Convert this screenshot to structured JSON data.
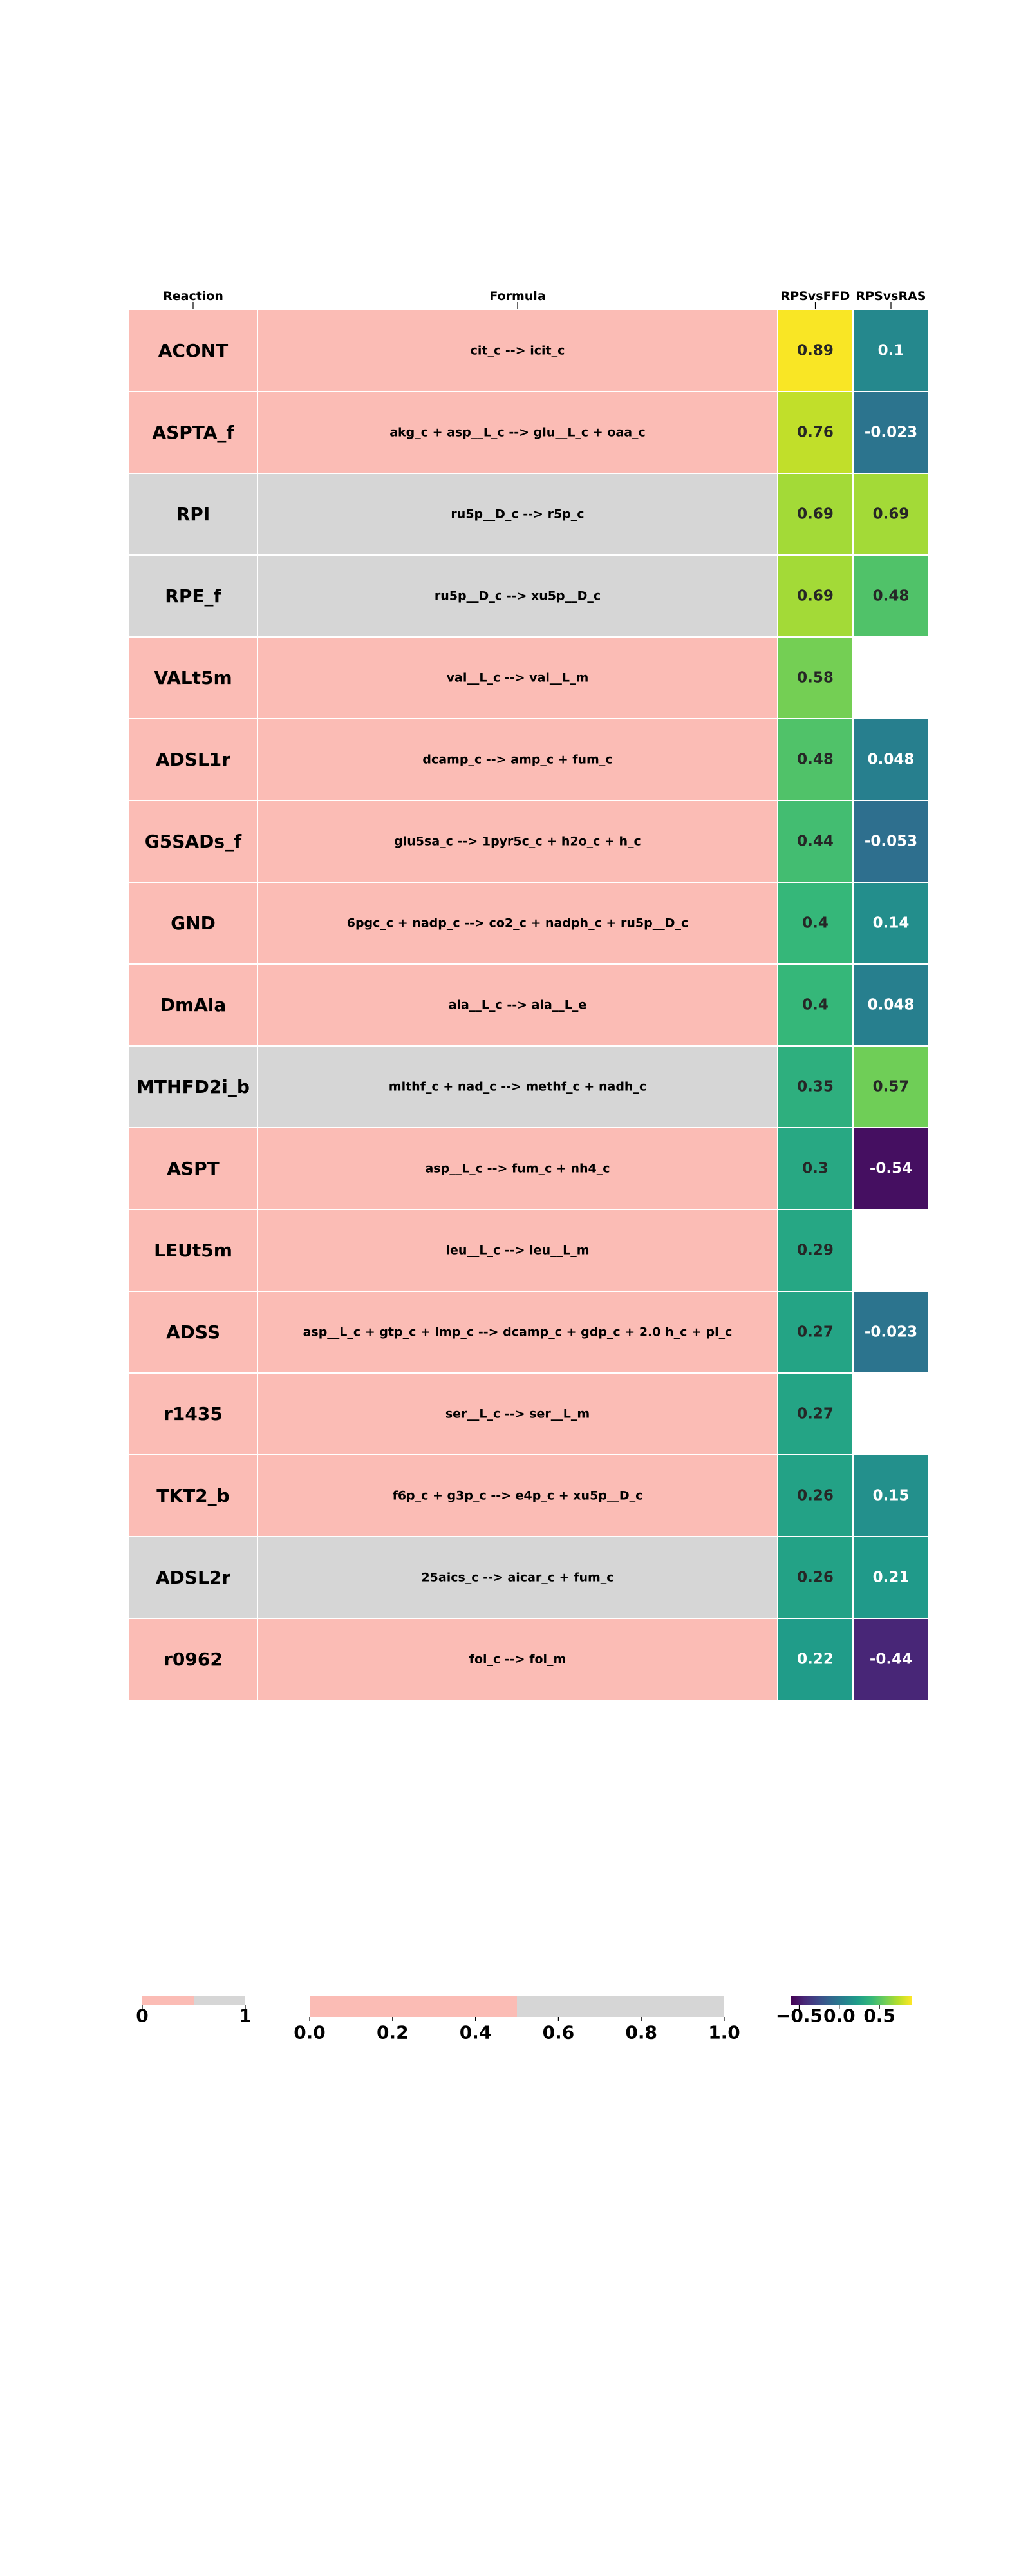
{
  "chart_data": {
    "type": "heatmap",
    "columns": [
      "Reaction",
      "Formula",
      "RPSvsFFD",
      "RPSvsRAS"
    ],
    "rows": [
      {
        "reaction": "ACONT",
        "formula": "cit_c --> icit_c",
        "category": 0,
        "RPSvsFFD": 0.89,
        "RPSvsRAS": 0.1,
        "labels": [
          "0.89",
          "0.1"
        ]
      },
      {
        "reaction": "ASPTA_f",
        "formula": "akg_c + asp__L_c --> glu__L_c + oaa_c",
        "category": 0,
        "RPSvsFFD": 0.76,
        "RPSvsRAS": -0.023,
        "labels": [
          "0.76",
          "-0.023"
        ]
      },
      {
        "reaction": "RPI",
        "formula": "ru5p__D_c --> r5p_c",
        "category": 1,
        "RPSvsFFD": 0.69,
        "RPSvsRAS": 0.69,
        "labels": [
          "0.69",
          "0.69"
        ]
      },
      {
        "reaction": "RPE_f",
        "formula": "ru5p__D_c --> xu5p__D_c",
        "category": 1,
        "RPSvsFFD": 0.69,
        "RPSvsRAS": 0.48,
        "labels": [
          "0.69",
          "0.48"
        ]
      },
      {
        "reaction": "VALt5m",
        "formula": "val__L_c --> val__L_m",
        "category": 0,
        "RPSvsFFD": 0.58,
        "RPSvsRAS": null,
        "labels": [
          "0.58",
          ""
        ]
      },
      {
        "reaction": "ADSL1r",
        "formula": "dcamp_c --> amp_c + fum_c",
        "category": 0,
        "RPSvsFFD": 0.48,
        "RPSvsRAS": 0.048,
        "labels": [
          "0.48",
          "0.048"
        ]
      },
      {
        "reaction": "G5SADs_f",
        "formula": "glu5sa_c --> 1pyr5c_c + h2o_c + h_c",
        "category": 0,
        "RPSvsFFD": 0.44,
        "RPSvsRAS": -0.053,
        "labels": [
          "0.44",
          "-0.053"
        ]
      },
      {
        "reaction": "GND",
        "formula": "6pgc_c + nadp_c --> co2_c + nadph_c + ru5p__D_c",
        "category": 0,
        "RPSvsFFD": 0.4,
        "RPSvsRAS": 0.14,
        "labels": [
          "0.4",
          "0.14"
        ]
      },
      {
        "reaction": "DmAla",
        "formula": "ala__L_c --> ala__L_e",
        "category": 0,
        "RPSvsFFD": 0.4,
        "RPSvsRAS": 0.048,
        "labels": [
          "0.4",
          "0.048"
        ]
      },
      {
        "reaction": "MTHFD2i_b",
        "formula": "mlthf_c + nad_c --> methf_c + nadh_c",
        "category": 1,
        "RPSvsFFD": 0.35,
        "RPSvsRAS": 0.57,
        "labels": [
          "0.35",
          "0.57"
        ]
      },
      {
        "reaction": "ASPT",
        "formula": "asp__L_c --> fum_c + nh4_c",
        "category": 0,
        "RPSvsFFD": 0.3,
        "RPSvsRAS": -0.54,
        "labels": [
          "0.3",
          "-0.54"
        ]
      },
      {
        "reaction": "LEUt5m",
        "formula": "leu__L_c --> leu__L_m",
        "category": 0,
        "RPSvsFFD": 0.29,
        "RPSvsRAS": null,
        "labels": [
          "0.29",
          ""
        ]
      },
      {
        "reaction": "ADSS",
        "formula": "asp__L_c + gtp_c + imp_c --> dcamp_c + gdp_c + 2.0 h_c + pi_c",
        "category": 0,
        "RPSvsFFD": 0.27,
        "RPSvsRAS": -0.023,
        "labels": [
          "0.27",
          "-0.023"
        ]
      },
      {
        "reaction": "r1435",
        "formula": "ser__L_c --> ser__L_m",
        "category": 0,
        "RPSvsFFD": 0.27,
        "RPSvsRAS": null,
        "labels": [
          "0.27",
          ""
        ]
      },
      {
        "reaction": "TKT2_b",
        "formula": "f6p_c + g3p_c --> e4p_c + xu5p__D_c",
        "category": 0,
        "RPSvsFFD": 0.26,
        "RPSvsRAS": 0.15,
        "labels": [
          "0.26",
          "0.15"
        ]
      },
      {
        "reaction": "ADSL2r",
        "formula": "25aics_c --> aicar_c + fum_c",
        "category": 1,
        "RPSvsFFD": 0.26,
        "RPSvsRAS": 0.21,
        "labels": [
          "0.26",
          "0.21"
        ]
      },
      {
        "reaction": "r0962",
        "formula": "fol_c --> fol_m",
        "category": 0,
        "RPSvsFFD": 0.22,
        "RPSvsRAS": -0.44,
        "labels": [
          "0.22",
          "-0.44"
        ]
      }
    ],
    "category_colors": [
      "#fbbcb5",
      "#d6d6d6"
    ],
    "value_colormap": "viridis",
    "value_range": [
      -0.6,
      0.9
    ],
    "colorbars": [
      {
        "ticks": [
          "0",
          "1"
        ],
        "stops": [
          "#fbbcb5",
          "#d6d6d6"
        ]
      },
      {
        "ticks": [
          "0.0",
          "0.2",
          "0.4",
          "0.6",
          "0.8",
          "1.0"
        ],
        "stops": [
          "#fbbcb5",
          "#d6d6d6"
        ]
      },
      {
        "ticks": [
          "−0.5",
          "0.0",
          "0.5"
        ],
        "colormap": "viridis"
      }
    ]
  }
}
